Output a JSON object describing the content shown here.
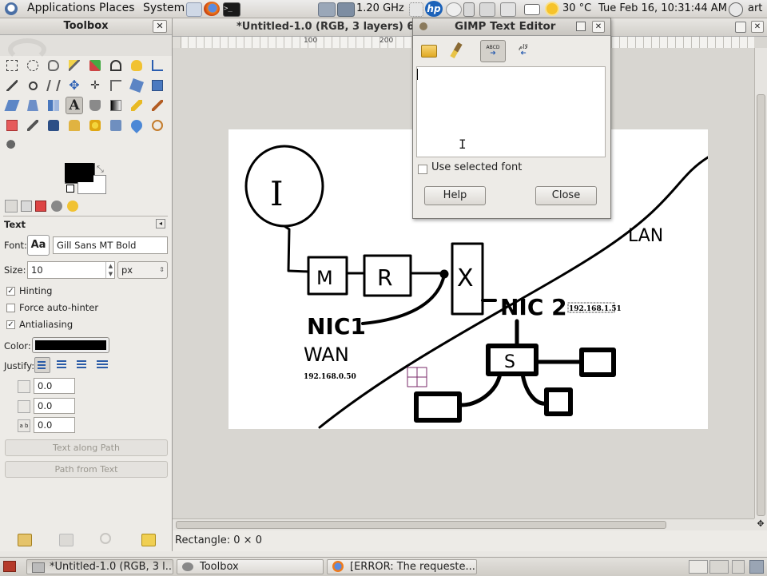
{
  "top_panel": {
    "menus": [
      "Applications",
      "Places",
      "System"
    ],
    "cpu_freq": "1.20 GHz",
    "temperature": "30 °C",
    "datetime": "Tue Feb 16, 10:31:44 AM",
    "user": "art"
  },
  "toolbox": {
    "title": "Toolbox",
    "tool_options_title": "Text",
    "font_label": "Font:",
    "font_preview": "Aa",
    "font_value": "Gill Sans MT Bold",
    "size_label": "Size:",
    "size_value": "10",
    "size_unit": "px",
    "hinting_label": "Hinting",
    "hinting_checked": true,
    "force_autohinter_label": "Force auto-hinter",
    "force_autohinter_checked": false,
    "antialiasing_label": "Antialiasing",
    "antialiasing_checked": true,
    "color_label": "Color:",
    "text_color": "#000000",
    "justify_label": "Justify:",
    "indent_value": "0.0",
    "line_spacing_value": "0.0",
    "letter_spacing_value": "0.0",
    "text_along_path": "Text along Path",
    "path_from_text": "Path from Text"
  },
  "image_window": {
    "title": "*Untitled-1.0 (RGB, 3 layers) 64",
    "ruler_marks": [
      "100",
      "200"
    ],
    "status_text": "Rectangle: 0 × 0"
  },
  "text_editor": {
    "title": "GIMP Text Editor",
    "use_selected_font_label": "Use selected font",
    "use_selected_font_checked": false,
    "help_label": "Help",
    "close_label": "Close",
    "text_value": ""
  },
  "drawing": {
    "labels": {
      "circle_letter": "I",
      "box_m": "M",
      "box_r": "R",
      "box_x": "X",
      "nic1": "NIC1",
      "wan": "WAN",
      "wan_ip": "192.168.0.50",
      "nic2": "NIC 2",
      "lan_ip": "192.168.1.51",
      "lan": "LAN",
      "switch": "S"
    }
  },
  "bottom_panel": {
    "tasks": [
      "*Untitled-1.0 (RGB, 3 l...",
      "Toolbox",
      "[ERROR: The requeste..."
    ]
  },
  "colors": {
    "panel": "#dcd9d4",
    "selection": "#7a2a6a",
    "accent_blue": "#3a6fbf"
  }
}
